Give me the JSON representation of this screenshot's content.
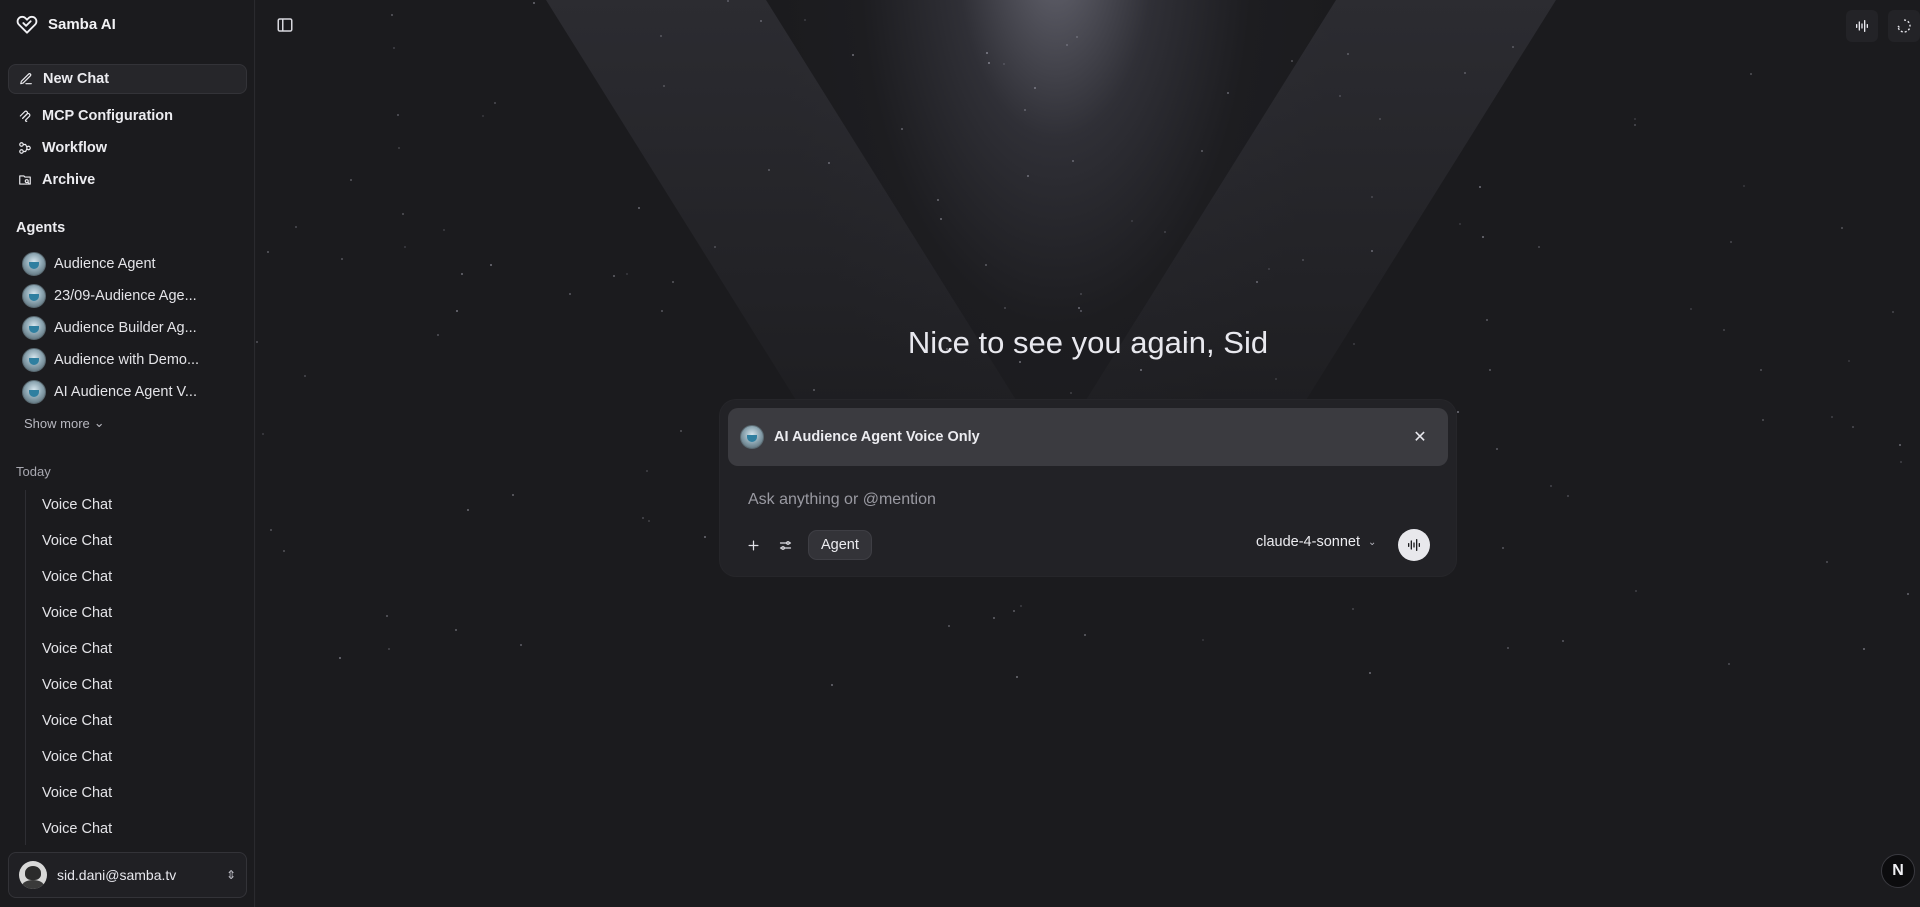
{
  "brand": {
    "name": "Samba AI",
    "icon": "heart-check-icon"
  },
  "nav": [
    {
      "label": "New Chat",
      "icon": "edit-icon",
      "active": true
    },
    {
      "label": "MCP Configuration",
      "icon": "mcp-icon"
    },
    {
      "label": "Workflow",
      "icon": "workflow-icon"
    },
    {
      "label": "Archive",
      "icon": "archive-icon"
    }
  ],
  "agents": {
    "title": "Agents",
    "items": [
      {
        "label": "Audience Agent"
      },
      {
        "label": "23/09-Audience Age..."
      },
      {
        "label": "Audience Builder Ag..."
      },
      {
        "label": "Audience with Demo..."
      },
      {
        "label": "AI Audience Agent V..."
      }
    ],
    "show_more": "Show more"
  },
  "history": {
    "group_label": "Today",
    "items": [
      "Voice Chat",
      "Voice Chat",
      "Voice Chat",
      "Voice Chat",
      "Voice Chat",
      "Voice Chat",
      "Voice Chat",
      "Voice Chat",
      "Voice Chat",
      "Voice Chat"
    ]
  },
  "user": {
    "email": "sid.dani@samba.tv"
  },
  "main": {
    "greeting": "Nice to see you again, Sid",
    "composer": {
      "selected_agent": "AI Audience Agent Voice Only",
      "placeholder": "Ask anything or @mention",
      "mode_pill": "Agent",
      "model": "claude-4-sonnet"
    },
    "corner_badge": "N"
  },
  "colors": {
    "background": "#1b1b1e",
    "sidebar": "#1b1b1e",
    "chip": "#3b3b40",
    "accent_light": "#e8e8ec"
  }
}
